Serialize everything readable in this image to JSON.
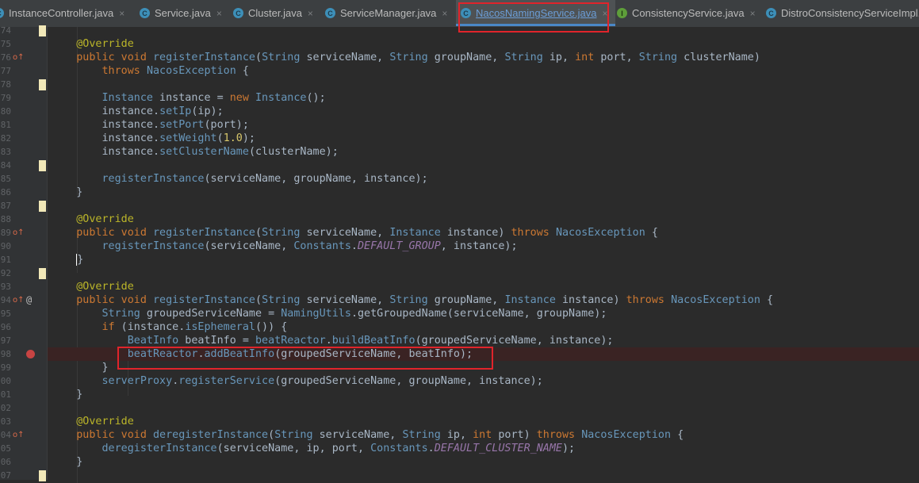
{
  "tabs": [
    {
      "label": "InstanceController.java",
      "icon": "class-icon",
      "active": false,
      "kind": "C"
    },
    {
      "label": "Service.java",
      "icon": "class-icon",
      "active": false,
      "kind": "C"
    },
    {
      "label": "Cluster.java",
      "icon": "class-icon",
      "active": false,
      "kind": "C"
    },
    {
      "label": "ServiceManager.java",
      "icon": "class-icon",
      "active": false,
      "kind": "C"
    },
    {
      "label": "NacosNamingService.java",
      "icon": "class-icon",
      "active": true,
      "kind": "C"
    },
    {
      "label": "ConsistencyService.java",
      "icon": "interface-icon",
      "active": false,
      "kind": "I"
    },
    {
      "label": "DistroConsistencyServiceImpl.j",
      "icon": "class-icon",
      "active": false,
      "kind": "C"
    }
  ],
  "close_glyph": "×",
  "line_numbers": [
    "74",
    "76",
    "77",
    "78",
    "79",
    "80",
    "81",
    "82",
    "83",
    "84",
    "85",
    "86",
    "87",
    "88",
    "89",
    "90",
    "91",
    "92",
    "93",
    "94",
    "95",
    "96",
    "97",
    "98",
    "99",
    "00",
    "01",
    "02",
    "03",
    "04",
    "05",
    "06",
    "07"
  ],
  "code_lines": [
    {
      "n": "74",
      "segs": []
    },
    {
      "n": "75",
      "segs": [
        [
          "annot",
          "    @Override"
        ]
      ]
    },
    {
      "n": "76",
      "segs": [
        [
          "kw",
          "    public void "
        ],
        [
          "meth",
          "registerInstance"
        ],
        [
          "p",
          "("
        ],
        [
          "cls",
          "String"
        ],
        [
          "p",
          " serviceName, "
        ],
        [
          "cls",
          "String"
        ],
        [
          "p",
          " groupName, "
        ],
        [
          "cls",
          "String"
        ],
        [
          "p",
          " ip, "
        ],
        [
          "kw",
          "int"
        ],
        [
          "p",
          " port, "
        ],
        [
          "cls",
          "String"
        ],
        [
          "p",
          " clusterName)"
        ]
      ]
    },
    {
      "n": "77",
      "segs": [
        [
          "kw",
          "        throws "
        ],
        [
          "cls",
          "NacosException"
        ],
        [
          "p",
          " {"
        ]
      ]
    },
    {
      "n": "78",
      "segs": []
    },
    {
      "n": "79",
      "segs": [
        [
          "cls",
          "        Instance"
        ],
        [
          "p",
          " instance = "
        ],
        [
          "kw",
          "new "
        ],
        [
          "cls",
          "Instance"
        ],
        [
          "p",
          "();"
        ]
      ]
    },
    {
      "n": "80",
      "segs": [
        [
          "p",
          "        instance."
        ],
        [
          "meth",
          "setIp"
        ],
        [
          "p",
          "(ip);"
        ]
      ]
    },
    {
      "n": "81",
      "segs": [
        [
          "p",
          "        instance."
        ],
        [
          "meth",
          "setPort"
        ],
        [
          "p",
          "(port);"
        ]
      ]
    },
    {
      "n": "82",
      "segs": [
        [
          "p",
          "        instance."
        ],
        [
          "meth",
          "setWeight"
        ],
        [
          "p",
          "("
        ],
        [
          "num2",
          "1.0"
        ],
        [
          "p",
          ");"
        ]
      ]
    },
    {
      "n": "83",
      "segs": [
        [
          "p",
          "        instance."
        ],
        [
          "meth",
          "setClusterName"
        ],
        [
          "p",
          "(clusterName);"
        ]
      ]
    },
    {
      "n": "84",
      "segs": []
    },
    {
      "n": "85",
      "segs": [
        [
          "meth",
          "        registerInstance"
        ],
        [
          "p",
          "(serviceName, groupName, instance);"
        ]
      ]
    },
    {
      "n": "86",
      "segs": [
        [
          "p",
          "    }"
        ]
      ]
    },
    {
      "n": "87",
      "segs": []
    },
    {
      "n": "88",
      "segs": [
        [
          "annot",
          "    @Override"
        ]
      ]
    },
    {
      "n": "89",
      "segs": [
        [
          "kw",
          "    public void "
        ],
        [
          "meth",
          "registerInstance"
        ],
        [
          "p",
          "("
        ],
        [
          "cls",
          "String"
        ],
        [
          "p",
          " serviceName, "
        ],
        [
          "cls",
          "Instance"
        ],
        [
          "p",
          " instance) "
        ],
        [
          "kw",
          "throws "
        ],
        [
          "cls",
          "NacosException"
        ],
        [
          "p",
          " {"
        ]
      ]
    },
    {
      "n": "90",
      "segs": [
        [
          "meth",
          "        registerInstance"
        ],
        [
          "p",
          "(serviceName, "
        ],
        [
          "cls",
          "Constants"
        ],
        [
          "p",
          "."
        ],
        [
          "const",
          "DEFAULT_GROUP"
        ],
        [
          "p",
          ", instance);"
        ]
      ]
    },
    {
      "n": "91",
      "segs": [
        [
          "p",
          "    "
        ],
        [
          "caret",
          ""
        ],
        [
          "p",
          "}"
        ]
      ]
    },
    {
      "n": "92",
      "segs": []
    },
    {
      "n": "93",
      "segs": [
        [
          "annot",
          "    @Override"
        ]
      ]
    },
    {
      "n": "94",
      "segs": [
        [
          "kw",
          "    public void "
        ],
        [
          "meth",
          "registerInstance"
        ],
        [
          "p",
          "("
        ],
        [
          "cls",
          "String"
        ],
        [
          "p",
          " serviceName, "
        ],
        [
          "cls",
          "String"
        ],
        [
          "p",
          " groupName, "
        ],
        [
          "cls",
          "Instance"
        ],
        [
          "p",
          " instance) "
        ],
        [
          "kw",
          "throws "
        ],
        [
          "cls",
          "NacosException"
        ],
        [
          "p",
          " {"
        ]
      ]
    },
    {
      "n": "95",
      "segs": [
        [
          "cls",
          "        String"
        ],
        [
          "p",
          " groupedServiceName = "
        ],
        [
          "cls",
          "NamingUtils"
        ],
        [
          "p",
          "."
        ],
        [
          "p",
          "getGroupedName(serviceName, groupName);"
        ]
      ]
    },
    {
      "n": "96",
      "segs": [
        [
          "kw",
          "        if"
        ],
        [
          "p",
          " (instance."
        ],
        [
          "meth",
          "isEphemeral"
        ],
        [
          "p",
          "()) {"
        ]
      ]
    },
    {
      "n": "97",
      "segs": [
        [
          "cls",
          "            BeatInfo"
        ],
        [
          "p",
          " beatInfo = "
        ],
        [
          "meth",
          "beatReactor"
        ],
        [
          "p",
          "."
        ],
        [
          "meth",
          "buildBeatInfo"
        ],
        [
          "p",
          "(groupedServiceName, instance);"
        ]
      ]
    },
    {
      "n": "98",
      "segs": [
        [
          "meth",
          "            beatReactor"
        ],
        [
          "p",
          "."
        ],
        [
          "meth",
          "addBeatInfo"
        ],
        [
          "p",
          "(groupedServiceName, beatInfo);"
        ]
      ]
    },
    {
      "n": "99",
      "segs": [
        [
          "p",
          "        }"
        ]
      ]
    },
    {
      "n": "00",
      "segs": [
        [
          "meth",
          "        serverProxy"
        ],
        [
          "p",
          "."
        ],
        [
          "meth",
          "registerService"
        ],
        [
          "p",
          "(groupedServiceName, groupName, instance);"
        ]
      ]
    },
    {
      "n": "01",
      "segs": [
        [
          "p",
          "    }"
        ]
      ]
    },
    {
      "n": "02",
      "segs": []
    },
    {
      "n": "03",
      "segs": [
        [
          "annot",
          "    @Override"
        ]
      ]
    },
    {
      "n": "04",
      "segs": [
        [
          "kw",
          "    public void "
        ],
        [
          "meth",
          "deregisterInstance"
        ],
        [
          "p",
          "("
        ],
        [
          "cls",
          "String"
        ],
        [
          "p",
          " serviceName, "
        ],
        [
          "cls",
          "String"
        ],
        [
          "p",
          " ip, "
        ],
        [
          "kw",
          "int"
        ],
        [
          "p",
          " port) "
        ],
        [
          "kw",
          "throws "
        ],
        [
          "cls",
          "NacosException"
        ],
        [
          "p",
          " {"
        ]
      ]
    },
    {
      "n": "05",
      "segs": [
        [
          "meth",
          "        deregisterInstance"
        ],
        [
          "p",
          "(serviceName, ip, port, "
        ],
        [
          "cls",
          "Constants"
        ],
        [
          "p",
          "."
        ],
        [
          "const",
          "DEFAULT_CLUSTER_NAME"
        ],
        [
          "p",
          ");"
        ]
      ]
    },
    {
      "n": "06",
      "segs": [
        [
          "p",
          "    }"
        ]
      ]
    },
    {
      "n": "07",
      "segs": []
    }
  ],
  "override_glyph": "o↑",
  "at_glyph": "@",
  "colors": {
    "annotation": "#bbb529",
    "keyword": "#cc7832",
    "type": "#6897bb",
    "constant": "#9876aa",
    "highlight": "#e0242b",
    "number": "#d7c76b"
  }
}
